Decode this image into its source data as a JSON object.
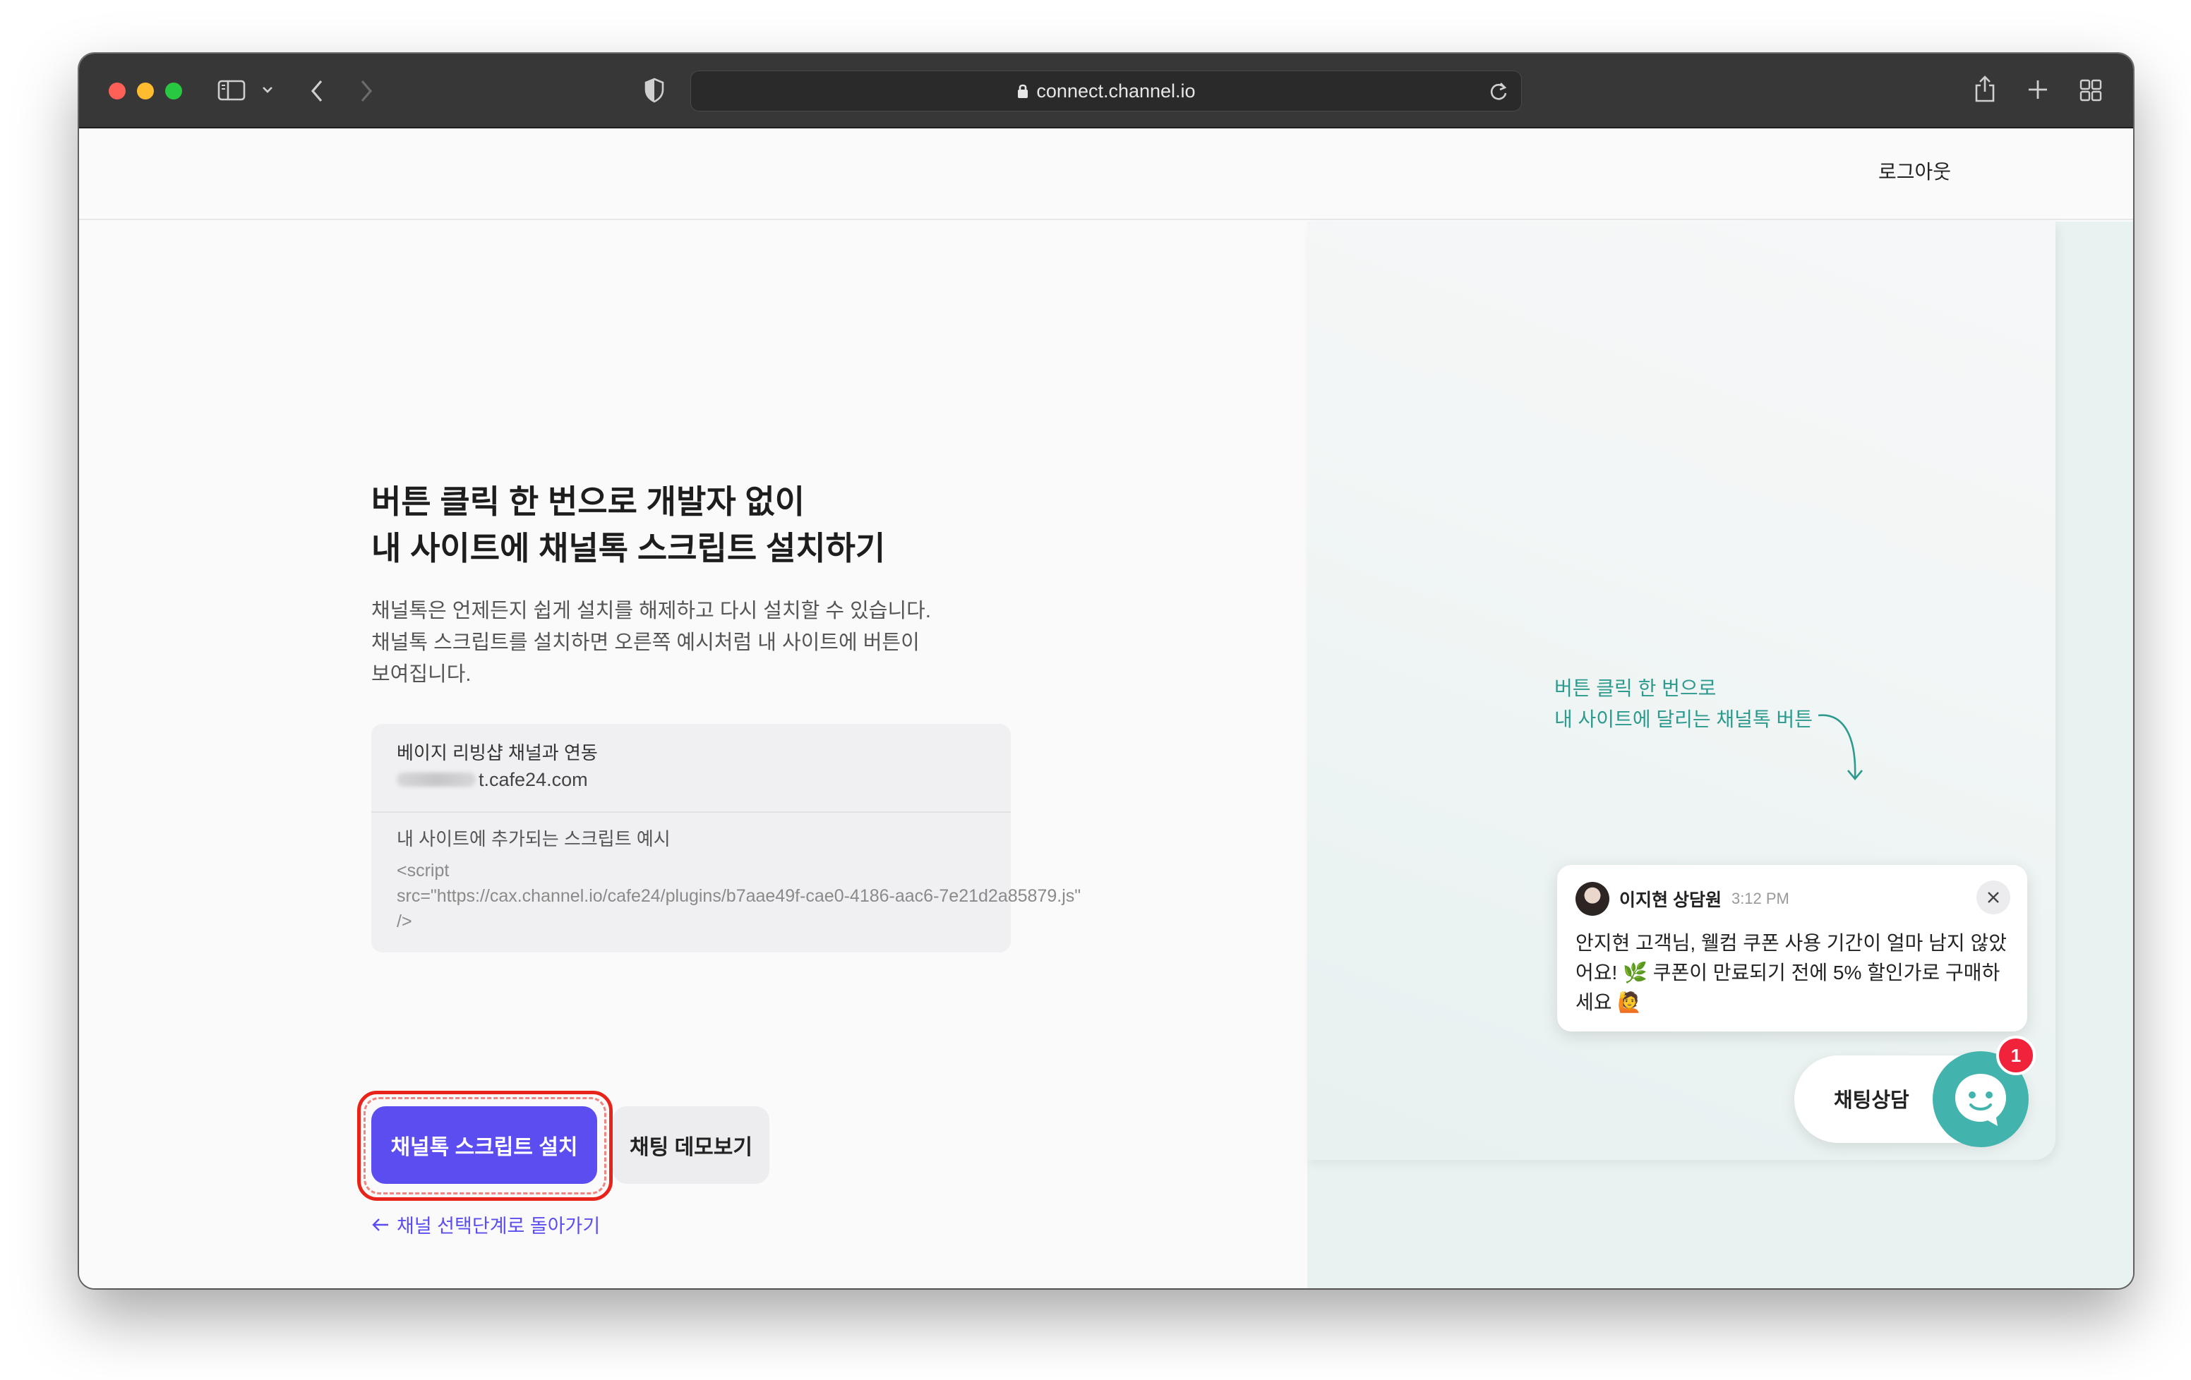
{
  "browser": {
    "url": "connect.channel.io"
  },
  "header": {
    "logout_label": "로그아웃"
  },
  "main": {
    "headline_line1": "버튼 클릭 한 번으로 개발자 없이",
    "headline_line2": "내 사이트에 채널톡 스크립트 설치하기",
    "desc_line1": "채널톡은 언제든지 쉽게 설치를 해제하고 다시 설치할 수 있습니다.",
    "desc_line2": "채널톡 스크립트를 설치하면 오른쪽 예시처럼 내 사이트에 버튼이",
    "desc_line3": "보여집니다.",
    "info": {
      "title": "베이지 리빙샵 채널과 연동",
      "domain_suffix": "t.cafe24.com",
      "script_label": "내 사이트에 추가되는 스크립트 예시",
      "script_line1": "<script",
      "script_line2": "src=\"https://cax.channel.io/cafe24/plugins/b7aae49f-cae0-4186-aac6-7e21d2a85879.js\"",
      "script_line3": "/>"
    },
    "install_button": "채널톡 스크립트 설치",
    "demo_button": "채팅 데모보기",
    "back_link": "채널 선택단계로 돌아가기"
  },
  "preview": {
    "hint_line1": "버튼 클릭 한 번으로",
    "hint_line2": "내 사이트에 달리는 채널톡 버튼",
    "agent_name": "이지현 상담원",
    "message_time": "3:12 PM",
    "message": "안지현 고객님, 웰컴 쿠폰 사용 기간이 얼마 남지 않았어요! 🌿 쿠폰이 만료되기 전에 5% 할인가로 구매하세요 🙋",
    "launcher_label": "채팅상담",
    "unread_count": "1"
  },
  "colors": {
    "primary": "#5c4df0",
    "teal": "#42b4ad",
    "hint_green": "#2c9a8c",
    "badge_red": "#f0233b",
    "annotation_red": "#e8231a"
  }
}
